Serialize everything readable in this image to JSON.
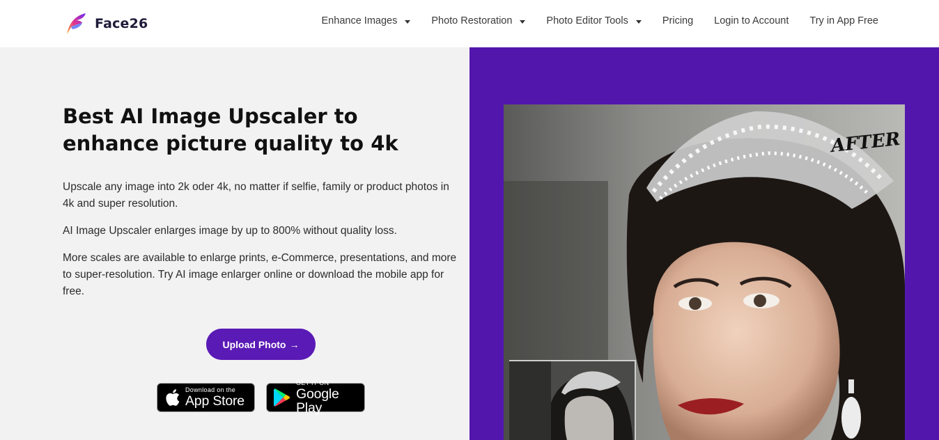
{
  "brand": {
    "name": "Face26",
    "accent_color": "#5216ad"
  },
  "nav": {
    "items": [
      {
        "label": "Enhance Images"
      },
      {
        "label": "Photo Restoration"
      },
      {
        "label": "Photo Editor Tools"
      },
      {
        "label": "Pricing"
      },
      {
        "label": "Login to Account"
      },
      {
        "label": "Try in App Free"
      }
    ]
  },
  "hero": {
    "title": "Best AI Image Upscaler to enhance picture quality to 4k",
    "paragraphs": [
      "Upscale any image into 2k oder 4k, no matter if selfie, family or product photos in 4k and super resolution.",
      "AI Image Upscaler enlarges image by up to 800% without quality loss.",
      "More scales are available to enlarge prints, e-Commerce, presentations, and more to super-resolution. Try AI image enlarger online or download the mobile app for free."
    ],
    "upload_label": "Upload Photo",
    "upload_arrow": "→"
  },
  "badges": {
    "apple_small": "Download on the",
    "apple_big": "App Store",
    "google_small": "GET IT ON",
    "google_big": "Google Play"
  },
  "photo": {
    "after_label": "AFTER"
  }
}
